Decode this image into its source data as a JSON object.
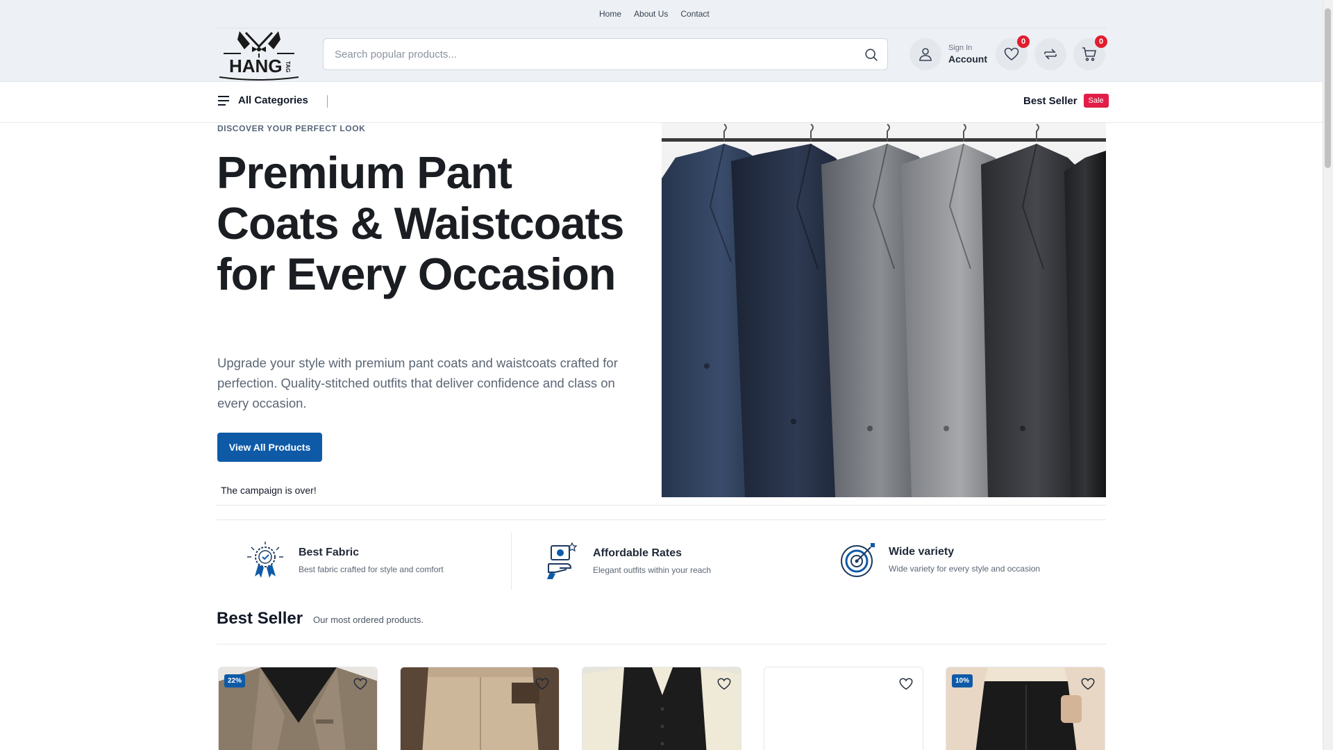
{
  "top_nav": {
    "links": [
      "Home",
      "About Us",
      "Contact"
    ]
  },
  "header": {
    "search_placeholder": "Search popular products...",
    "account_small": "Sign In",
    "account_big": "Account",
    "wishlist_count": "0",
    "cart_count": "0",
    "logo_text": "HANG",
    "logo_small": "TAG"
  },
  "catbar": {
    "all_categories": "All Categories",
    "best_seller": "Best Seller",
    "sale_tag": "Sale"
  },
  "hero": {
    "eyebrow": "DISCOVER YOUR PERFECT LOOK",
    "title": "Premium Pant Coats & Waistcoats for Every Occasion",
    "description": "Upgrade your style with premium pant coats and waistcoats crafted for perfection. Quality-stitched outfits that deliver confidence and class on every occasion.",
    "button": "View All Products",
    "campaign": "The campaign is over!"
  },
  "features": [
    {
      "title": "Best Fabric",
      "desc": "Best fabric crafted for style and comfort",
      "icon": "award-badge-icon"
    },
    {
      "title": "Affordable Rates",
      "desc": "Elegant outfits within your reach",
      "icon": "price-hand-icon"
    },
    {
      "title": "Wide variety",
      "desc": "Wide variety for every style and occasion",
      "icon": "target-icon"
    }
  ],
  "best_seller": {
    "title": "Best Seller",
    "subtitle": "Our most ordered products.",
    "products": [
      {
        "discount": "22%",
        "image": "tweed-blazer"
      },
      {
        "discount": "",
        "image": "beige-trousers"
      },
      {
        "discount": "",
        "image": "black-waistcoat"
      },
      {
        "discount": "",
        "image": "blank"
      },
      {
        "discount": "10%",
        "image": "black-trousers"
      }
    ]
  },
  "colors": {
    "accent": "#0e5aa7",
    "badge": "#e11d2e",
    "sale": "#e11d48"
  }
}
